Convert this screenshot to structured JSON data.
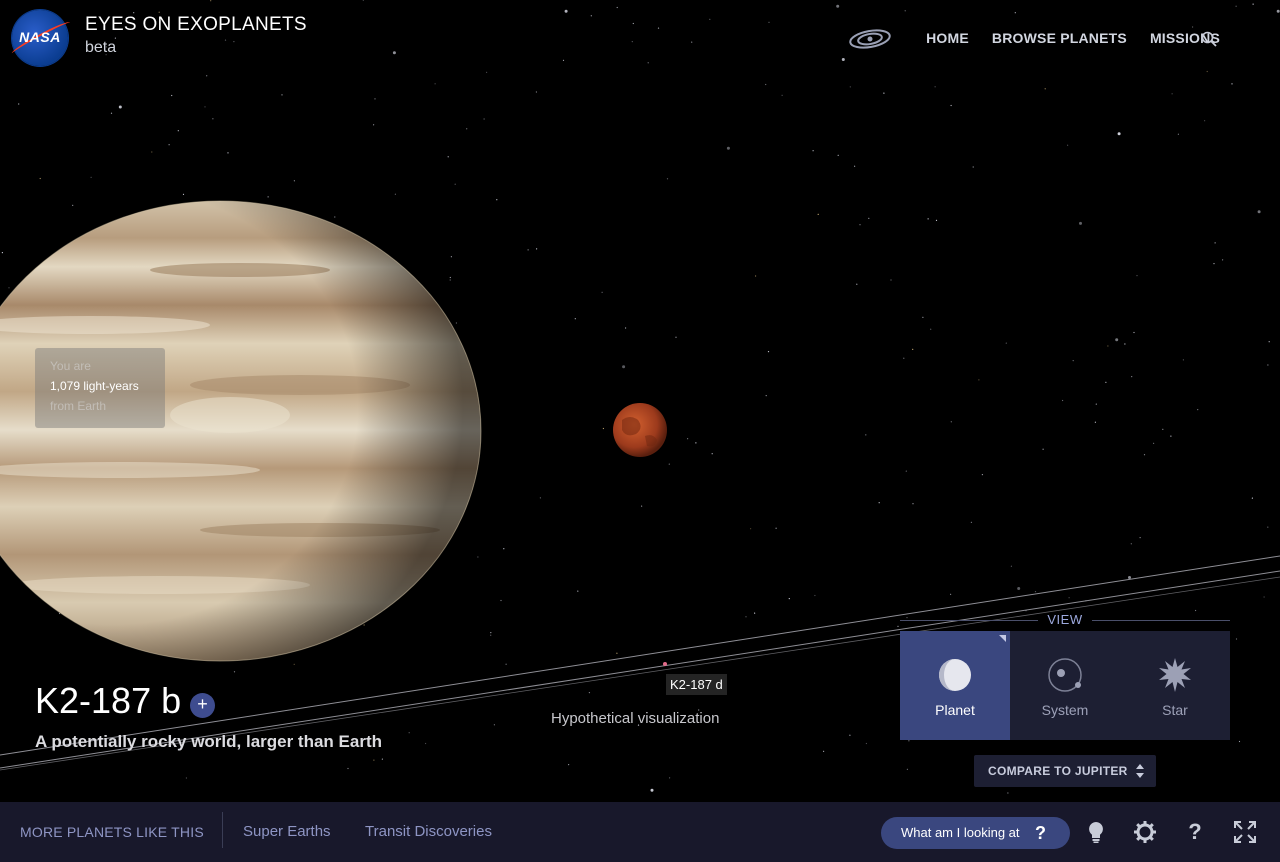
{
  "header": {
    "logo_text": "NASA",
    "title": "EYES ON EXOPLANETS",
    "subtitle": "beta",
    "nav": [
      {
        "label": "HOME",
        "icon": "galaxy-icon"
      },
      {
        "label": "BROWSE PLANETS"
      },
      {
        "label": "MISSIONS"
      }
    ],
    "search_icon": "search-icon"
  },
  "distance_box": {
    "line1": "You are",
    "line2": "1,079 light-years",
    "line3": "from Earth"
  },
  "planet": {
    "name": "K2-187 b",
    "description": "A potentially rocky world, larger than Earth",
    "expand_label": "+"
  },
  "scene": {
    "secondary_label": "K2-187 d",
    "caption": "Hypothetical visualization"
  },
  "view": {
    "title": "VIEW",
    "options": [
      {
        "label": "Planet",
        "icon": "planet-icon",
        "active": true
      },
      {
        "label": "System",
        "icon": "system-icon",
        "active": false
      },
      {
        "label": "Star",
        "icon": "star-icon",
        "active": false
      }
    ],
    "compare_label": "COMPARE TO JUPITER"
  },
  "bottom_bar": {
    "more_title": "MORE PLANETS LIKE THIS",
    "categories": [
      "Super Earths",
      "Transit Discoveries"
    ],
    "looking_label": "What am I looking at",
    "looking_icon": "question-icon",
    "tools": [
      "lightbulb-icon",
      "settings-icon",
      "help-icon",
      "fullscreen-icon"
    ]
  },
  "colors": {
    "accent": "#3a477f",
    "bar_bg": "#18182b",
    "link": "#8e95c4"
  }
}
